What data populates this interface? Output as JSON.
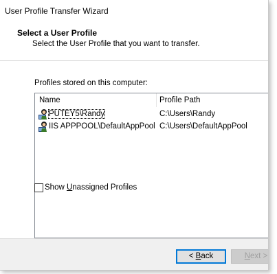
{
  "window": {
    "title": "User Profile Transfer Wizard"
  },
  "header": {
    "title": "Select a User Profile",
    "subtitle": "Select the User Profile that you want to transfer."
  },
  "profiles": {
    "group_label": "Profiles stored on this computer:",
    "columns": [
      "Name",
      "Profile Path"
    ],
    "rows": [
      {
        "name": "PUTEY5\\Randy",
        "path": "C:\\Users\\Randy",
        "icon": "user-profile-icon",
        "focused": true
      },
      {
        "name": "IIS APPPOOL\\DefaultAppPool",
        "path": "C:\\Users\\DefaultAppPool",
        "icon": "user-profile-icon",
        "focused": false
      }
    ]
  },
  "options": {
    "show_unassigned_prefix": "Show ",
    "show_unassigned_accel": "U",
    "show_unassigned_suffix": "nassigned Profiles",
    "show_unassigned_checked": false
  },
  "buttons": {
    "back_prefix": "< ",
    "back_accel": "B",
    "back_suffix": "ack",
    "next_prefix": "",
    "next_accel": "N",
    "next_suffix": "ext >",
    "next_enabled": false
  },
  "colors": {
    "accent": "#0078d7",
    "window_bg": "#f0f0f0",
    "panel_bg": "#ffffff"
  }
}
